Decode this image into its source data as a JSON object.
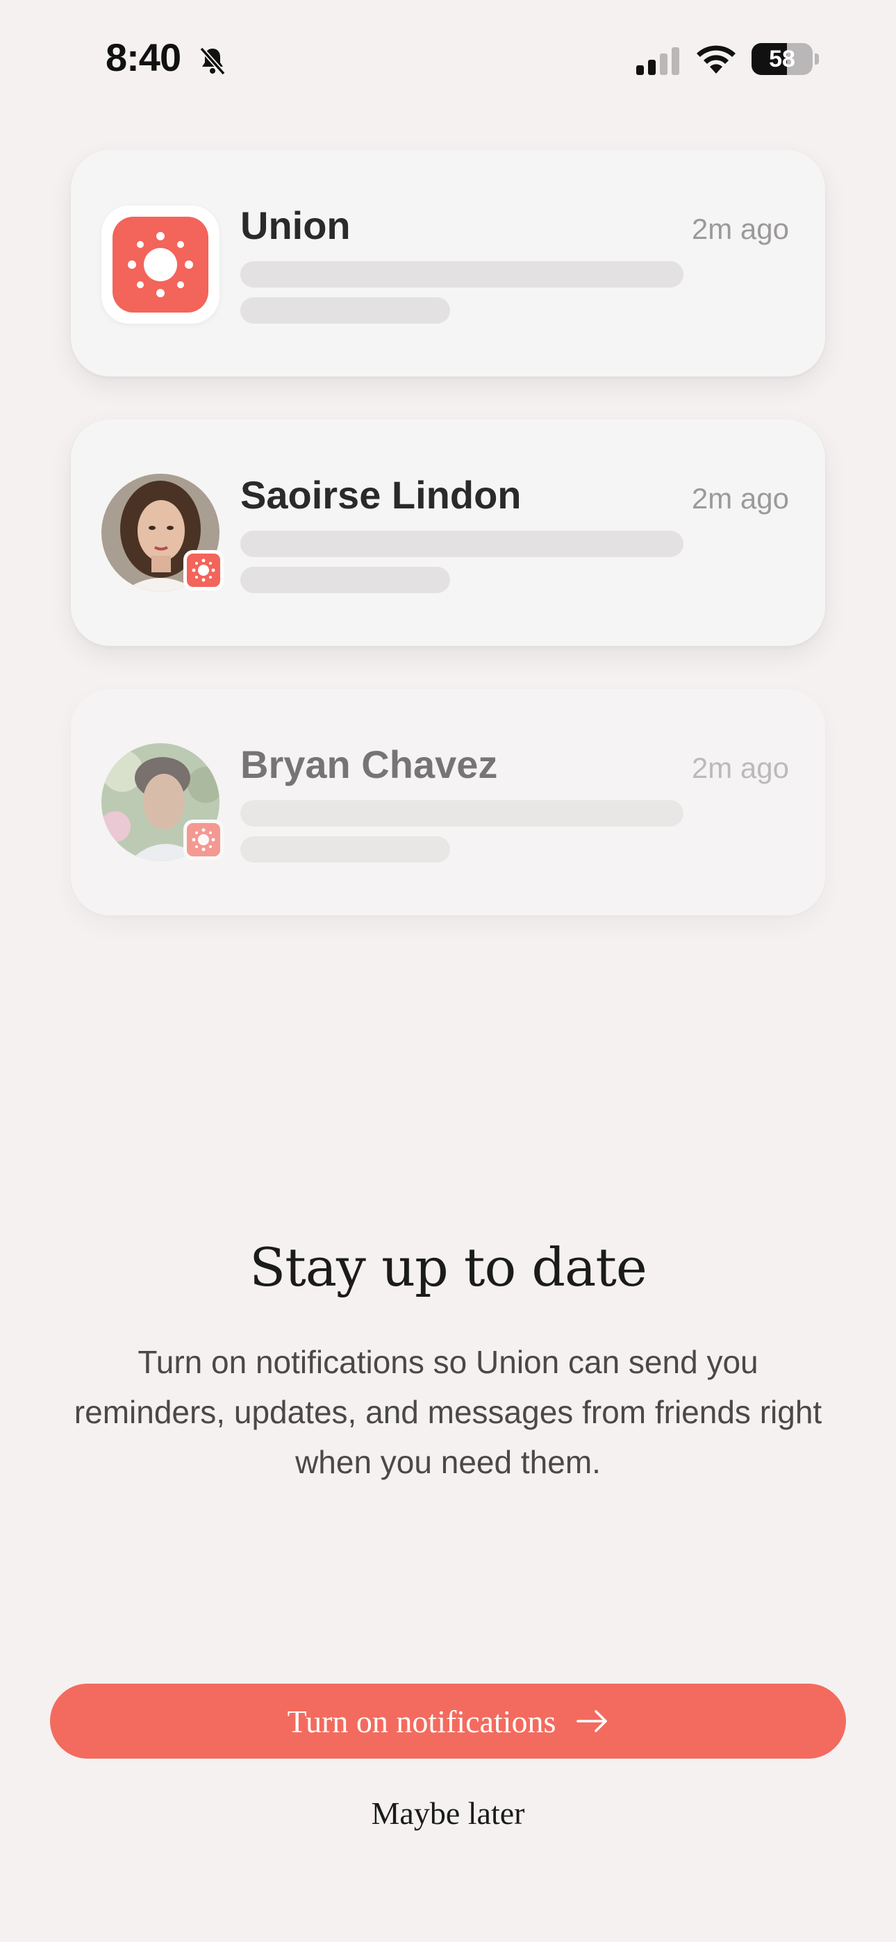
{
  "status_bar": {
    "time": "8:40",
    "battery_level": "58",
    "battery_fraction": 0.58,
    "icons": [
      "bell-slash-icon",
      "signal-icon",
      "wifi-icon",
      "battery-icon"
    ]
  },
  "notifications": [
    {
      "title": "Union",
      "time": "2m ago",
      "icon": "union-app-icon"
    },
    {
      "title": "Saoirse Lindon",
      "time": "2m ago",
      "icon": "avatar"
    },
    {
      "title": "Bryan Chavez",
      "time": "2m ago",
      "icon": "avatar"
    }
  ],
  "content": {
    "headline": "Stay up to date",
    "body": "Turn on notifications so Union can send you reminders, updates, and messages from friends right when you need them."
  },
  "actions": {
    "primary_label": "Turn on notifications",
    "secondary_label": "Maybe later"
  },
  "colors": {
    "accent": "#f36b5e",
    "background": "#f4f1f0"
  }
}
